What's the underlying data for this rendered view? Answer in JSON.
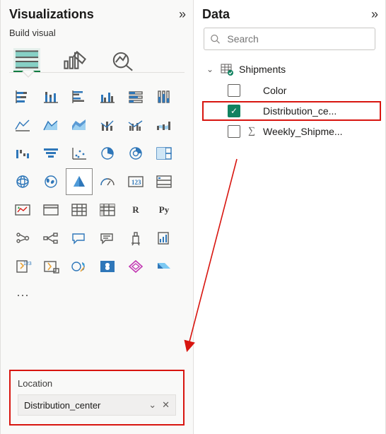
{
  "viz": {
    "title": "Visualizations",
    "collapse_glyph": "»",
    "subtitle": "Build visual",
    "tabs": {
      "build": "Build visual",
      "format": "Format visual",
      "analytics": "Analytics"
    },
    "more_glyph": "···",
    "well": {
      "label": "Location",
      "field": "Distribution_center",
      "dropdown_glyph": "⌄",
      "remove_glyph": "✕"
    }
  },
  "data": {
    "title": "Data",
    "collapse_glyph": "»",
    "search_placeholder": "Search",
    "table": {
      "name": "Shipments",
      "fields": [
        {
          "name": "Color",
          "checked": false,
          "sigma": false,
          "highlighted": false
        },
        {
          "name": "Distribution_ce...",
          "checked": true,
          "sigma": false,
          "highlighted": true
        },
        {
          "name": "Weekly_Shipme...",
          "checked": false,
          "sigma": true,
          "highlighted": false
        }
      ]
    }
  }
}
